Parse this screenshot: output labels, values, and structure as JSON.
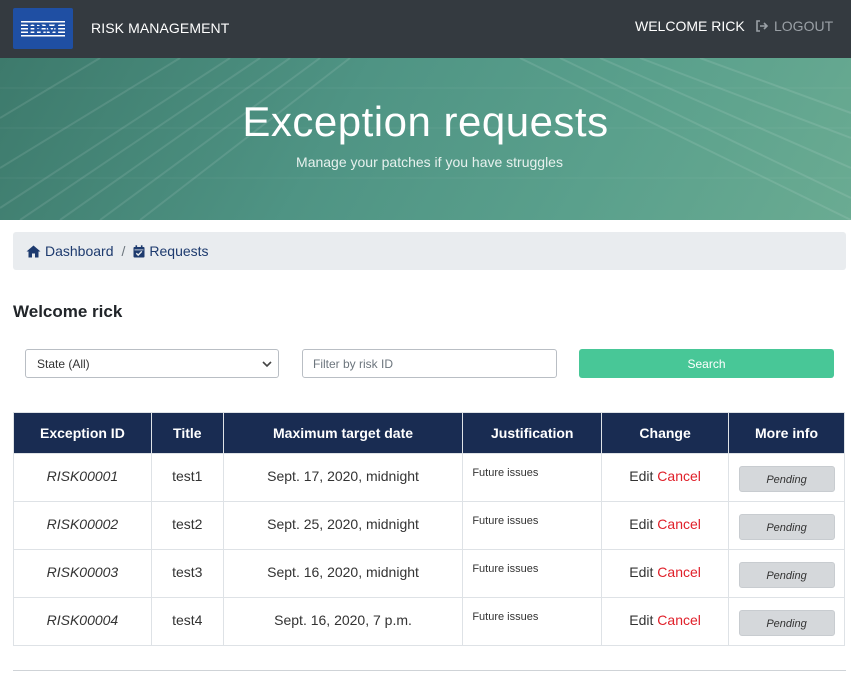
{
  "navbar": {
    "logo_text": "IBM",
    "brand": "RISK MANAGEMENT",
    "welcome": "WELCOME RICK",
    "logout": "LOGOUT",
    "logout_icon": "sign-out-icon"
  },
  "hero": {
    "title": "Exception requests",
    "subtitle": "Manage your patches if you have struggles"
  },
  "breadcrumb": {
    "items": [
      {
        "label": "Dashboard",
        "icon": "home-icon"
      },
      {
        "label": "Requests",
        "icon": "calendar-check-icon"
      }
    ],
    "separator": "/"
  },
  "welcome_heading": "Welcome rick",
  "filters": {
    "state_selected": "State (All)",
    "risk_placeholder": "Filter by risk ID",
    "search_label": "Search"
  },
  "table": {
    "headers": [
      "Exception ID",
      "Title",
      "Maximum target date",
      "Justification",
      "Change",
      "More info"
    ],
    "rows": [
      {
        "id": "RISK00001",
        "title": "test1",
        "date": "Sept. 17, 2020, midnight",
        "justification": "Future issues",
        "edit": "Edit",
        "cancel": "Cancel",
        "info": "Pending"
      },
      {
        "id": "RISK00002",
        "title": "test2",
        "date": "Sept. 25, 2020, midnight",
        "justification": "Future issues",
        "edit": "Edit",
        "cancel": "Cancel",
        "info": "Pending"
      },
      {
        "id": "RISK00003",
        "title": "test3",
        "date": "Sept. 16, 2020, midnight",
        "justification": "Future issues",
        "edit": "Edit",
        "cancel": "Cancel",
        "info": "Pending"
      },
      {
        "id": "RISK00004",
        "title": "test4",
        "date": "Sept. 16, 2020, 7 p.m.",
        "justification": "Future issues",
        "edit": "Edit",
        "cancel": "Cancel",
        "info": "Pending"
      }
    ]
  },
  "colors": {
    "navbar_bg": "#343a40",
    "table_header_bg": "#192c52",
    "search_button": "#48c797",
    "cancel_link": "#e0202a",
    "hero_tint": "#4f9484"
  }
}
